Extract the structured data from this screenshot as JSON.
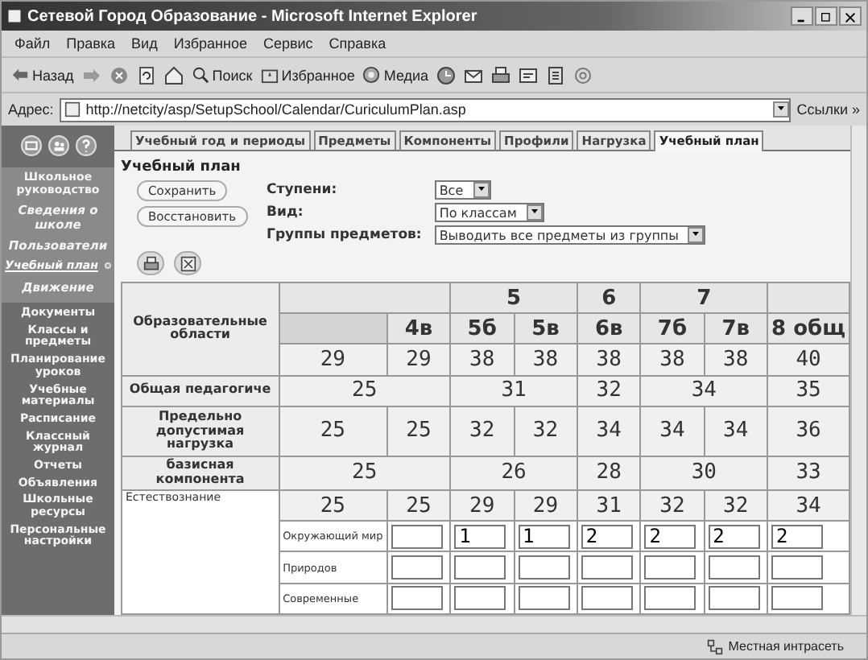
{
  "window": {
    "title": "Сетевой Город Образование - Microsoft Internet Explorer"
  },
  "menu": [
    "Файл",
    "Правка",
    "Вид",
    "Избранное",
    "Сервис",
    "Справка"
  ],
  "toolbar": [
    {
      "kind": "back",
      "label": "Назад"
    },
    {
      "kind": "forward"
    },
    {
      "kind": "stop"
    },
    {
      "kind": "refresh"
    },
    {
      "kind": "home"
    },
    {
      "kind": "search",
      "label": "Поиск"
    },
    {
      "kind": "favorites",
      "label": "Избранное"
    },
    {
      "kind": "media",
      "label": "Медиа"
    },
    {
      "kind": "history"
    },
    {
      "kind": "mail"
    },
    {
      "kind": "print"
    },
    {
      "kind": "edit"
    },
    {
      "kind": "discuss"
    },
    {
      "kind": "messenger"
    }
  ],
  "address": {
    "label": "Адрес:",
    "url": "http://netcity/asp/SetupSchool/Calendar/CuriculumPlan.asp",
    "links": "Ссылки »"
  },
  "sidebar": {
    "group": {
      "title": "Школьное руководство",
      "items": [
        {
          "label": "Сведения о школе",
          "selected": false
        },
        {
          "label": "Пользователи",
          "selected": false
        },
        {
          "label": "Учебный план",
          "selected": true
        },
        {
          "label": "Движение",
          "selected": false
        }
      ]
    },
    "items": [
      "Документы",
      "Классы и предметы",
      "Планирование уроков",
      "Учебные материалы",
      "Расписание",
      "Классный журнал",
      "Отчеты",
      "Объявления",
      "Школьные ресурсы",
      "Персональные настройки"
    ]
  },
  "tabs": [
    {
      "label": "Учебный год и периоды",
      "selected": false
    },
    {
      "label": "Предметы",
      "selected": false
    },
    {
      "label": "Компоненты",
      "selected": false
    },
    {
      "label": "Профили",
      "selected": false
    },
    {
      "label": "Нагрузка",
      "selected": false
    },
    {
      "label": "Учебный план",
      "selected": true
    }
  ],
  "page_title": "Учебный план",
  "buttons": [
    "Сохранить",
    "Восстановить"
  ],
  "filters": [
    {
      "label": "Ступени:",
      "value": "Все"
    },
    {
      "label": "Вид:",
      "value": "По классам"
    },
    {
      "label": "Группы предметов:",
      "value": "Выводить все предметы из группы"
    }
  ],
  "table": {
    "corner": "Образовательные области",
    "groups": [
      {
        "classes": [
          {
            "cut": true
          },
          {
            "label": "4в"
          }
        ]
      },
      {
        "label": "5",
        "classes": [
          {
            "label": "5б"
          },
          {
            "label": "5в"
          }
        ]
      },
      {
        "label": "6",
        "classes": [
          {
            "label": "6в"
          }
        ]
      },
      {
        "label": "7",
        "classes": [
          {
            "label": "7б"
          },
          {
            "label": "7в"
          }
        ]
      },
      {
        "classes": [
          {
            "label": "8 общ"
          }
        ]
      }
    ],
    "totals": [
      "29",
      "29",
      "38",
      "38",
      "38",
      "38",
      "38",
      "40"
    ],
    "rows": [
      {
        "kind": "per_group",
        "label": "Общая педагогиче",
        "values": [
          "25",
          "31",
          "32",
          "34",
          "35"
        ]
      },
      {
        "kind": "per_class",
        "label": "Предельно допустимая нагрузка",
        "values": [
          "25",
          "25",
          "32",
          "32",
          "34",
          "34",
          "34",
          "36"
        ]
      },
      {
        "kind": "per_group",
        "label": "базисная компонента",
        "values": [
          "25",
          "26",
          "28",
          "30",
          "33"
        ]
      }
    ],
    "area": {
      "label": "Естествознание",
      "totals": [
        "25",
        "25",
        "29",
        "29",
        "31",
        "32",
        "32",
        "34"
      ],
      "subjects": [
        {
          "label": "Окружающий мир",
          "values": [
            "1",
            "1",
            "2",
            "2",
            "2",
            "2"
          ]
        },
        {
          "label": "Природов"
        },
        {
          "label": "Современные"
        }
      ]
    }
  },
  "status_bar": {
    "zone": "Местная интрасеть"
  }
}
